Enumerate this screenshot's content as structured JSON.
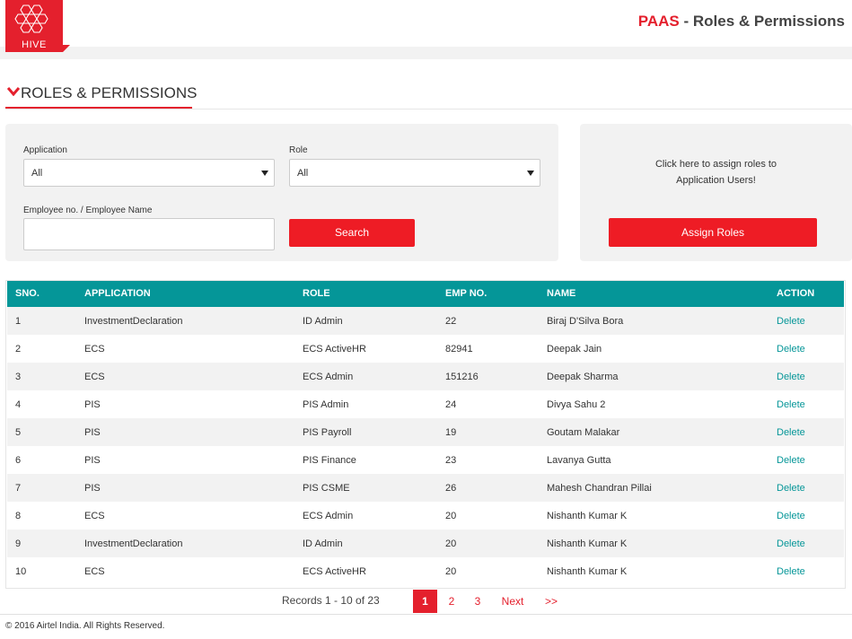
{
  "header": {
    "logo_text": "HIVE",
    "brand": "PAAS",
    "title_rest": " - Roles & Permissions"
  },
  "section": {
    "title": "ROLES & PERMISSIONS"
  },
  "filters": {
    "application_label": "Application",
    "application_value": "All",
    "role_label": "Role",
    "role_value": "All",
    "employee_label": "Employee no. / Employee Name",
    "employee_value": "",
    "search_label": "Search"
  },
  "assign": {
    "text_line1": "Click here to assign roles to",
    "text_line2": "Application Users!",
    "button_label": "Assign Roles"
  },
  "table": {
    "columns": [
      "SNO.",
      "APPLICATION",
      "ROLE",
      "EMP NO.",
      "NAME",
      "ACTION"
    ],
    "rows": [
      {
        "sno": "1",
        "application": "InvestmentDeclaration",
        "role": "ID Admin",
        "emp": "22",
        "name": "Biraj D'Silva Bora",
        "action": "Delete"
      },
      {
        "sno": "2",
        "application": "ECS",
        "role": "ECS ActiveHR",
        "emp": "82941",
        "name": "Deepak Jain",
        "action": "Delete"
      },
      {
        "sno": "3",
        "application": "ECS",
        "role": "ECS Admin",
        "emp": "151216",
        "name": "Deepak Sharma",
        "action": "Delete"
      },
      {
        "sno": "4",
        "application": "PIS",
        "role": "PIS Admin",
        "emp": "24",
        "name": "Divya Sahu 2",
        "action": "Delete"
      },
      {
        "sno": "5",
        "application": "PIS",
        "role": "PIS Payroll",
        "emp": "19",
        "name": "Goutam Malakar",
        "action": "Delete"
      },
      {
        "sno": "6",
        "application": "PIS",
        "role": "PIS Finance",
        "emp": "23",
        "name": "Lavanya Gutta",
        "action": "Delete"
      },
      {
        "sno": "7",
        "application": "PIS",
        "role": "PIS CSME",
        "emp": "26",
        "name": "Mahesh Chandran Pillai",
        "action": "Delete"
      },
      {
        "sno": "8",
        "application": "ECS",
        "role": "ECS Admin",
        "emp": "20",
        "name": "Nishanth Kumar K",
        "action": "Delete"
      },
      {
        "sno": "9",
        "application": "InvestmentDeclaration",
        "role": "ID Admin",
        "emp": "20",
        "name": "Nishanth Kumar K",
        "action": "Delete"
      },
      {
        "sno": "10",
        "application": "ECS",
        "role": "ECS ActiveHR",
        "emp": "20",
        "name": "Nishanth Kumar K",
        "action": "Delete"
      }
    ]
  },
  "pagination": {
    "records_text": "Records 1 - 10 of 23",
    "pages": [
      "1",
      "2",
      "3"
    ],
    "next_label": "Next",
    "last_label": ">>"
  },
  "footer": {
    "copyright": "© 2016 Airtel India. All Rights Reserved."
  },
  "colors": {
    "brand_red": "#e4202d",
    "teal": "#059698"
  }
}
